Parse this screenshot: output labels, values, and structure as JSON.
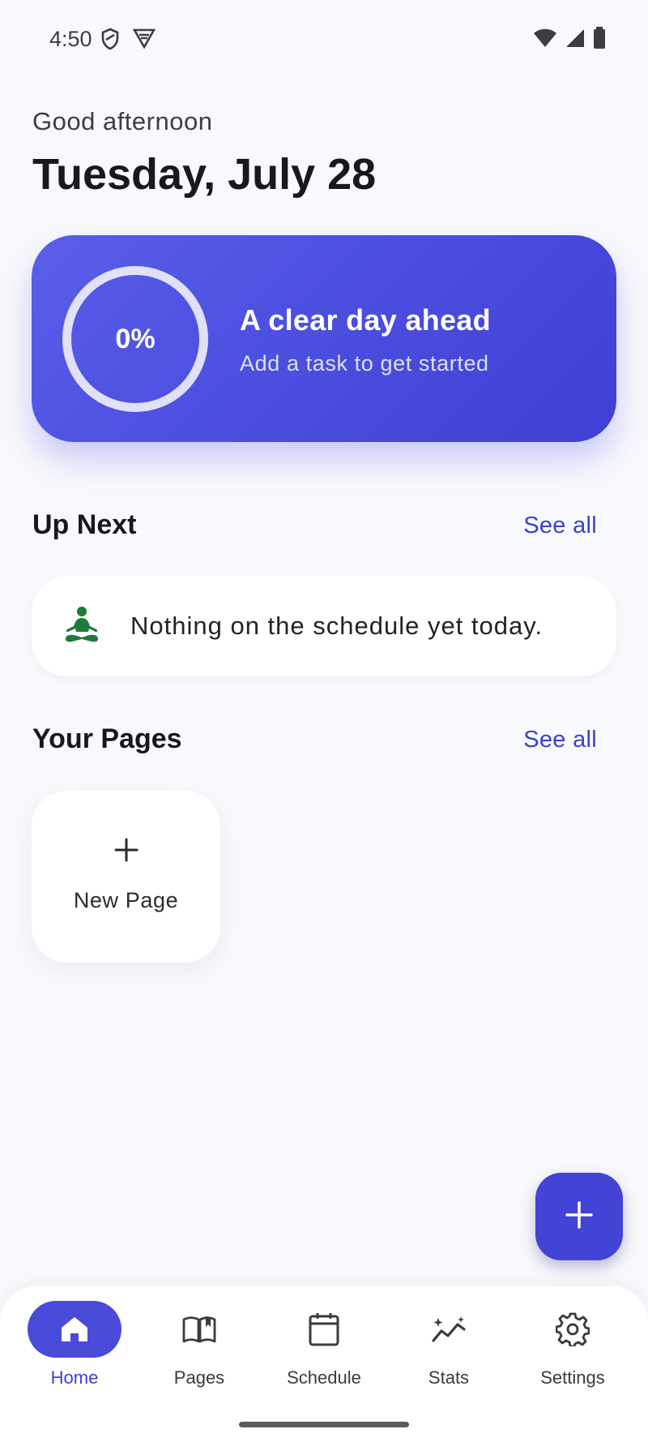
{
  "status_bar": {
    "time": "4:50",
    "left_icons": [
      "shield-icon",
      "vpn-icon"
    ],
    "right_icons": [
      "wifi-icon",
      "signal-icon",
      "battery-icon"
    ]
  },
  "header": {
    "greeting": "Good afternoon",
    "date": "Tuesday, July 28"
  },
  "progress_card": {
    "percent_label": "0%",
    "progress": 0,
    "title": "A clear day ahead",
    "subtitle": "Add a task to get started"
  },
  "up_next": {
    "title": "Up Next",
    "see_all": "See all",
    "empty_text": "Nothing on the schedule yet today.",
    "empty_icon": "meditation-icon"
  },
  "pages": {
    "title": "Your Pages",
    "see_all": "See all",
    "new_page_label": "New Page"
  },
  "fab": {
    "icon": "plus-icon"
  },
  "nav": {
    "items": [
      {
        "label": "Home",
        "icon": "home-icon",
        "active": true
      },
      {
        "label": "Pages",
        "icon": "book-icon",
        "active": false
      },
      {
        "label": "Schedule",
        "icon": "calendar-icon",
        "active": false
      },
      {
        "label": "Stats",
        "icon": "stats-icon",
        "active": false
      },
      {
        "label": "Settings",
        "icon": "gear-icon",
        "active": false
      }
    ]
  },
  "colors": {
    "accent": "#4343d6",
    "card_gradient_start": "#5a5ee8",
    "card_gradient_end": "#4040d4",
    "background": "#f8f9fc",
    "meditation_icon": "#1f7a3a"
  }
}
